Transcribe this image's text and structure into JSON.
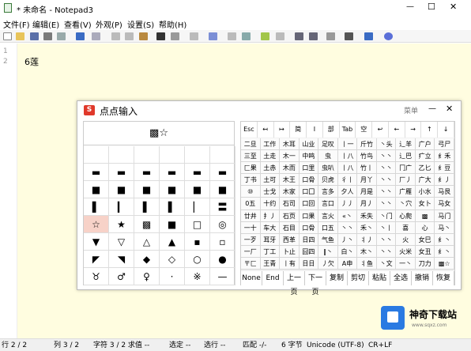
{
  "window": {
    "title": "* 未命名 - Notepad3",
    "min": "—",
    "max": "☐",
    "close": "✕"
  },
  "menu": [
    "文件(F)",
    "编辑(E)",
    "查看(V)",
    "外观(P)",
    "设置(S)",
    "帮助(H)"
  ],
  "editor": {
    "line_numbers": [
      "1",
      "2"
    ],
    "lines": [
      "",
      "6莲"
    ]
  },
  "ime": {
    "title": "点点输入",
    "menu_label": "菜单",
    "min": "—",
    "close": "✕",
    "preview": "▩☆",
    "left_grid": [
      [
        "",
        "",
        "",
        "",
        "",
        ""
      ],
      [
        "▬",
        "▬",
        "▬",
        "▬",
        "▬",
        "▬"
      ],
      [
        "■",
        "■",
        "■",
        "■",
        "■",
        "■"
      ],
      [
        "▌",
        "▎",
        "▌",
        "▌",
        "▏",
        "〓"
      ],
      [
        "☆",
        "★",
        "▩",
        "■",
        "□",
        "◎"
      ],
      [
        "▼",
        "▽",
        "△",
        "▲",
        "▪",
        "▫"
      ],
      [
        "◤",
        "◥",
        "◆",
        "◇",
        "○",
        "●"
      ],
      [
        "♉",
        "♂",
        "♀",
        "·",
        "※",
        "—"
      ]
    ],
    "right_header": [
      "Esc",
      "↤",
      "↦",
      "简",
      "I",
      "部",
      "Tab",
      "空",
      "↩",
      "←",
      "→",
      "↑",
      "↓"
    ],
    "right_grid": [
      [
        "二旦",
        "工作",
        "木耳",
        "山业",
        "足叹",
        "丨一",
        "斤竹",
        "丶头",
        "辶羊",
        "广户",
        "弓尸"
      ],
      [
        "三至",
        "土走",
        "木一",
        "中鸣",
        "虫",
        "丨八",
        "竹鸟",
        "丶丶",
        "辶巴",
        "疒立",
        "纟禾"
      ],
      [
        "匚果",
        "土赤",
        "木而",
        "口里",
        "虫叭",
        "丨八",
        "竹丨",
        "丶丶",
        "冂广",
        "乙匕",
        "纟豆"
      ],
      [
        "丁书",
        "土可",
        "木王",
        "口骨",
        "贝虎",
        "彳丨",
        "月丫",
        "丶丶",
        "厂丿",
        "广大",
        "纟丿"
      ],
      [
        "⑩",
        "士戈",
        "木家",
        "口囗",
        "言多",
        "夕人",
        "月是",
        "丶丶",
        "广雁",
        "小水",
        "马艮"
      ],
      [
        "0五",
        "十约",
        "石司",
        "口回",
        "言口",
        "丿丿",
        "月丿",
        "丶丶",
        "丶穴",
        "女卜",
        "马女"
      ],
      [
        "廿井",
        "扌丿",
        "石页",
        "口果",
        "言火",
        "«丶",
        "禾失",
        "丶门",
        "心爬",
        "▩",
        "马门"
      ],
      [
        "一十",
        "车大",
        "石目",
        "口骨",
        "口五",
        "丶丶",
        "禾丶",
        "丶丨",
        "喜",
        "心",
        "马丶"
      ],
      [
        "一歹",
        "耳牙",
        "西革",
        "日四",
        "气鱼",
        "丿丶",
        "丬丿",
        "丶丶",
        "火",
        "女巳",
        "纟丶"
      ],
      [
        "一厂",
        "丁工",
        "卜止",
        "囧四",
        "‖丶",
        "白丶",
        "木丶",
        "丶丶",
        "火米",
        "女丑",
        "纟丶"
      ],
      [
        "〒匚",
        "王青",
        "丨有",
        "日日",
        "丿欠",
        "A申",
        "丬鱼",
        "丶文",
        "一丶",
        "刀力",
        "▩☆"
      ]
    ],
    "bottom": [
      "None",
      "End",
      "上一页",
      "下一页",
      "复制",
      "剪切",
      "粘贴",
      "全选",
      "撤销",
      "恢复"
    ]
  },
  "status": {
    "pos": "行 2 / 2",
    "col": "列 3 / 2",
    "chars": "字符 3 / 2 求值 --",
    "sel": "选定 --",
    "sel_lines": "选行 --",
    "match": "匹配 -/-",
    "bytes": "6 字节",
    "encoding": "Unicode (UTF-8)",
    "eol": "CR+LF"
  },
  "watermark": {
    "text": "神奇下载站",
    "url": "www.sqxz.com"
  },
  "colors": {
    "editor_bg": "#fffde0",
    "selected_cell": "#f7d2c8",
    "logo_red": "#e0392b"
  }
}
